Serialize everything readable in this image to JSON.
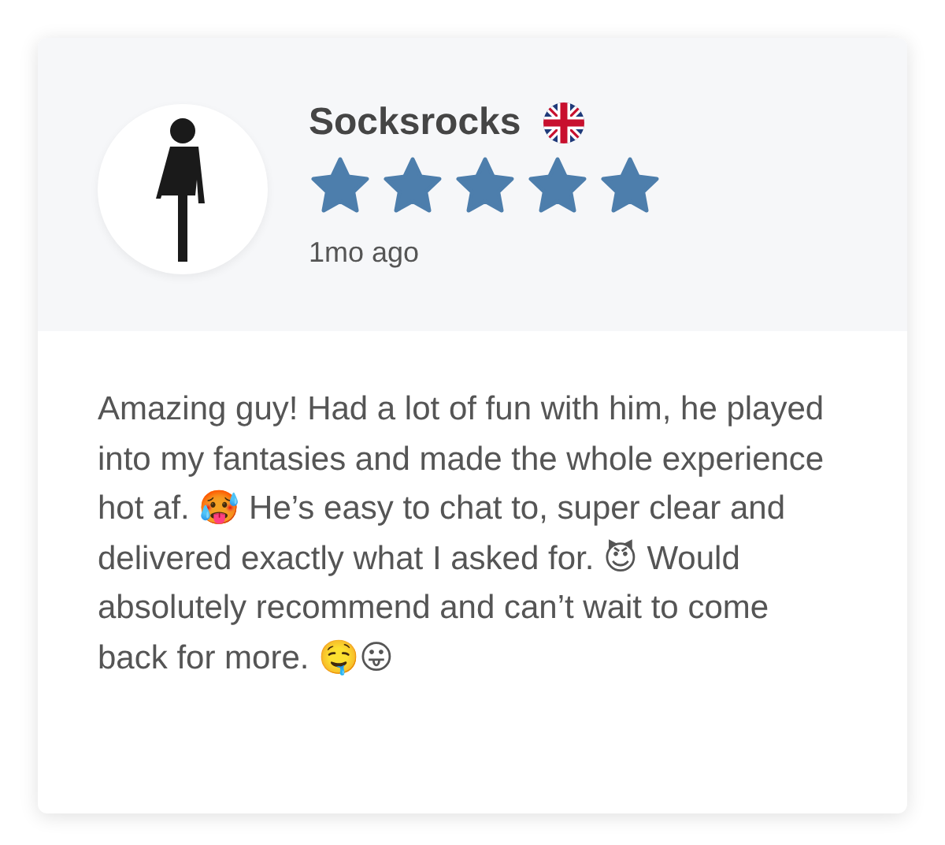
{
  "review": {
    "name": "Socksrocks",
    "stars": 5,
    "time": "1mo ago",
    "text": "Amazing guy! Had a lot of fun with him, he played into my fantasies and made the whole experience hot af. 🥵 He’s easy to chat to, super clear and delivered exactly what I asked for. 😈 Would absolutely recommend and can’t wait to come back for more. 🤤😛"
  }
}
